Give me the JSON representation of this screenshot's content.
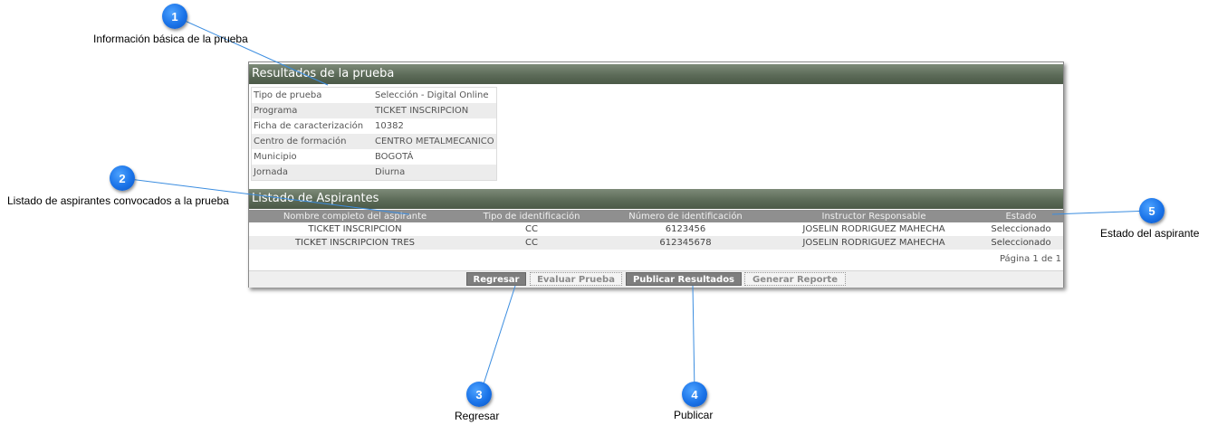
{
  "callouts": [
    {
      "num": "1",
      "text": "Información básica de la prueba"
    },
    {
      "num": "2",
      "text": "Listado de aspirantes convocados a la prueba"
    },
    {
      "num": "3",
      "text": "Regresar"
    },
    {
      "num": "4",
      "text": "Publicar"
    },
    {
      "num": "5",
      "text": "Estado del aspirante"
    }
  ],
  "results": {
    "title": "Resultados de la prueba",
    "info": [
      {
        "label": "Tipo de prueba",
        "value": "Selección - Digital Online"
      },
      {
        "label": "Programa",
        "value": "TICKET INSCRIPCION"
      },
      {
        "label": "Ficha de caracterización",
        "value": "10382"
      },
      {
        "label": "Centro de formación",
        "value": "CENTRO METALMECANICO"
      },
      {
        "label": "Municipio",
        "value": "BOGOTÁ"
      },
      {
        "label": "Jornada",
        "value": "Diurna"
      }
    ]
  },
  "list": {
    "title": "Listado de Aspirantes",
    "columns": [
      "Nombre completo del aspirante",
      "Tipo de identificación",
      "Número de identificación",
      "Instructor Responsable",
      "Estado"
    ],
    "rows": [
      [
        "TICKET INSCRIPCION",
        "CC",
        "6123456",
        "JOSELIN RODRIGUEZ MAHECHA",
        "Seleccionado"
      ],
      [
        "TICKET INSCRIPCION TRES",
        "CC",
        "612345678",
        "JOSELIN RODRIGUEZ MAHECHA",
        "Seleccionado"
      ]
    ],
    "pager": "Página 1 de 1"
  },
  "buttons": {
    "regresar": "Regresar",
    "evaluar": "Evaluar Prueba",
    "publicar": "Publicar Resultados",
    "reporte": "Generar Reporte"
  }
}
